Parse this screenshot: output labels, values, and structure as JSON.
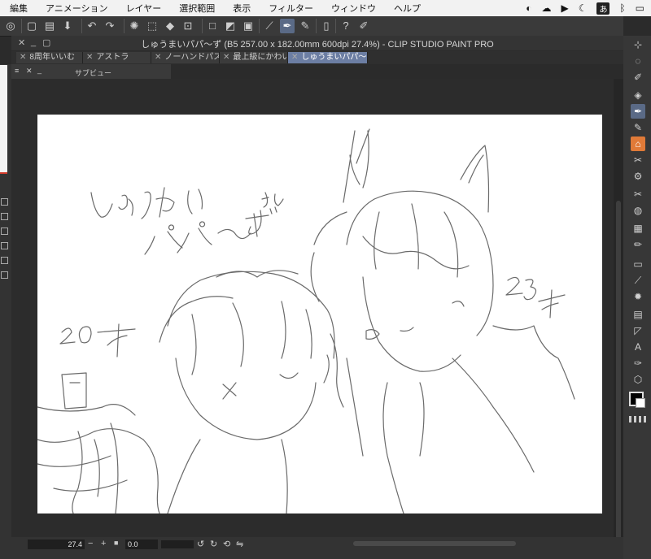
{
  "menubar": {
    "items": [
      "編集",
      "アニメーション",
      "レイヤー",
      "選択範囲",
      "表示",
      "フィルター",
      "ウィンドウ",
      "ヘルプ"
    ],
    "ime_label": "あ"
  },
  "window": {
    "title": "しゅうまいパパ〜ず (B5 257.00 x 182.00mm 600dpi 27.4%)  - CLIP STUDIO PAINT PRO"
  },
  "tabs": [
    {
      "label": "8周年いいむ",
      "active": false
    },
    {
      "label": "アストラ",
      "active": false
    },
    {
      "label": "ノーハンドパス",
      "active": false
    },
    {
      "label": "最上級にかわい",
      "active": false
    },
    {
      "label": "しゅうまいパパ〜ず",
      "active": true
    }
  ],
  "subview": {
    "label": "サブビュー"
  },
  "canvas": {
    "sketch_text": [
      "しゅうまい",
      "パパ〜ず",
      "さん",
      "20才",
      "23才"
    ]
  },
  "statusbar": {
    "zoom_value": "27.4",
    "rotation_value": "0.0",
    "minus": "−",
    "plus": "+"
  },
  "colors": {
    "accent": "#5a6a86",
    "active_tab": "#6c7ea3",
    "highlight_tool": "#e07a38",
    "main_color": "#000000",
    "sub_color": "#ffffff"
  },
  "icons": {
    "toolbar": [
      "csp-logo-icon",
      "new-file-icon",
      "open-file-icon",
      "save-icon",
      "undo-icon",
      "redo-icon",
      "loading-icon",
      "selection-icon",
      "fill-icon",
      "transform-icon",
      "clear-icon",
      "ruler-icon",
      "pen-icon",
      "pencil-icon",
      "device-icon",
      "help-icon",
      "pen-settings-icon"
    ],
    "right_toolbar": [
      "select-icon",
      "lasso-icon",
      "eyedropper-icon",
      "eraser-icon",
      "pen-icon",
      "brush-icon",
      "home-icon",
      "tool-icon",
      "gear-icon",
      "tool2-icon",
      "drop-icon",
      "tone-icon",
      "pencil-icon",
      "gauge-icon",
      "line-icon",
      "burst-icon",
      "frame-icon",
      "arrow-icon",
      "text-icon",
      "brush2-icon",
      "cube-icon"
    ]
  }
}
